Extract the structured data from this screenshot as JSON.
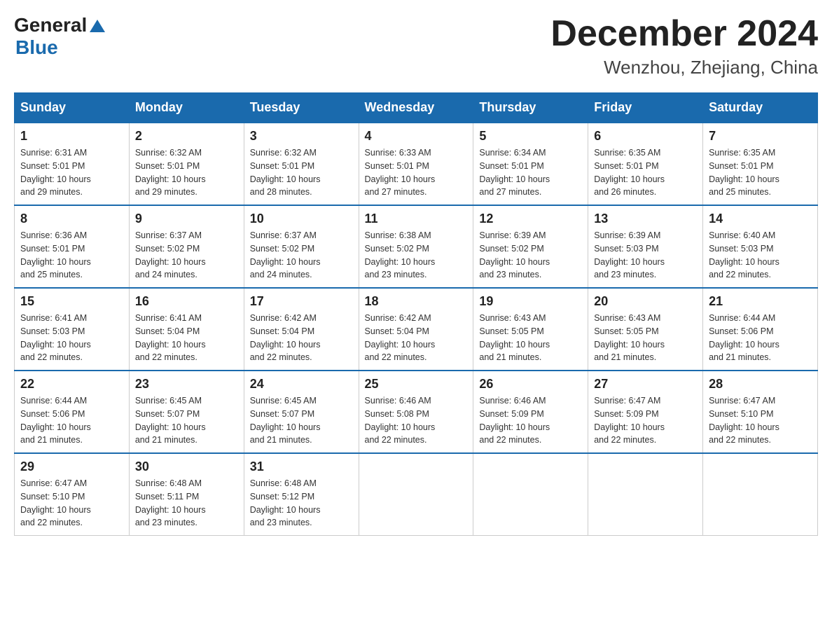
{
  "header": {
    "logo": {
      "general": "General",
      "blue": "Blue",
      "alt": "GeneralBlue logo"
    },
    "title": "December 2024",
    "subtitle": "Wenzhou, Zhejiang, China"
  },
  "weekdays": [
    "Sunday",
    "Monday",
    "Tuesday",
    "Wednesday",
    "Thursday",
    "Friday",
    "Saturday"
  ],
  "weeks": [
    [
      {
        "day": "1",
        "sunrise": "6:31 AM",
        "sunset": "5:01 PM",
        "daylight": "10 hours and 29 minutes."
      },
      {
        "day": "2",
        "sunrise": "6:32 AM",
        "sunset": "5:01 PM",
        "daylight": "10 hours and 29 minutes."
      },
      {
        "day": "3",
        "sunrise": "6:32 AM",
        "sunset": "5:01 PM",
        "daylight": "10 hours and 28 minutes."
      },
      {
        "day": "4",
        "sunrise": "6:33 AM",
        "sunset": "5:01 PM",
        "daylight": "10 hours and 27 minutes."
      },
      {
        "day": "5",
        "sunrise": "6:34 AM",
        "sunset": "5:01 PM",
        "daylight": "10 hours and 27 minutes."
      },
      {
        "day": "6",
        "sunrise": "6:35 AM",
        "sunset": "5:01 PM",
        "daylight": "10 hours and 26 minutes."
      },
      {
        "day": "7",
        "sunrise": "6:35 AM",
        "sunset": "5:01 PM",
        "daylight": "10 hours and 25 minutes."
      }
    ],
    [
      {
        "day": "8",
        "sunrise": "6:36 AM",
        "sunset": "5:01 PM",
        "daylight": "10 hours and 25 minutes."
      },
      {
        "day": "9",
        "sunrise": "6:37 AM",
        "sunset": "5:02 PM",
        "daylight": "10 hours and 24 minutes."
      },
      {
        "day": "10",
        "sunrise": "6:37 AM",
        "sunset": "5:02 PM",
        "daylight": "10 hours and 24 minutes."
      },
      {
        "day": "11",
        "sunrise": "6:38 AM",
        "sunset": "5:02 PM",
        "daylight": "10 hours and 23 minutes."
      },
      {
        "day": "12",
        "sunrise": "6:39 AM",
        "sunset": "5:02 PM",
        "daylight": "10 hours and 23 minutes."
      },
      {
        "day": "13",
        "sunrise": "6:39 AM",
        "sunset": "5:03 PM",
        "daylight": "10 hours and 23 minutes."
      },
      {
        "day": "14",
        "sunrise": "6:40 AM",
        "sunset": "5:03 PM",
        "daylight": "10 hours and 22 minutes."
      }
    ],
    [
      {
        "day": "15",
        "sunrise": "6:41 AM",
        "sunset": "5:03 PM",
        "daylight": "10 hours and 22 minutes."
      },
      {
        "day": "16",
        "sunrise": "6:41 AM",
        "sunset": "5:04 PM",
        "daylight": "10 hours and 22 minutes."
      },
      {
        "day": "17",
        "sunrise": "6:42 AM",
        "sunset": "5:04 PM",
        "daylight": "10 hours and 22 minutes."
      },
      {
        "day": "18",
        "sunrise": "6:42 AM",
        "sunset": "5:04 PM",
        "daylight": "10 hours and 22 minutes."
      },
      {
        "day": "19",
        "sunrise": "6:43 AM",
        "sunset": "5:05 PM",
        "daylight": "10 hours and 21 minutes."
      },
      {
        "day": "20",
        "sunrise": "6:43 AM",
        "sunset": "5:05 PM",
        "daylight": "10 hours and 21 minutes."
      },
      {
        "day": "21",
        "sunrise": "6:44 AM",
        "sunset": "5:06 PM",
        "daylight": "10 hours and 21 minutes."
      }
    ],
    [
      {
        "day": "22",
        "sunrise": "6:44 AM",
        "sunset": "5:06 PM",
        "daylight": "10 hours and 21 minutes."
      },
      {
        "day": "23",
        "sunrise": "6:45 AM",
        "sunset": "5:07 PM",
        "daylight": "10 hours and 21 minutes."
      },
      {
        "day": "24",
        "sunrise": "6:45 AM",
        "sunset": "5:07 PM",
        "daylight": "10 hours and 21 minutes."
      },
      {
        "day": "25",
        "sunrise": "6:46 AM",
        "sunset": "5:08 PM",
        "daylight": "10 hours and 22 minutes."
      },
      {
        "day": "26",
        "sunrise": "6:46 AM",
        "sunset": "5:09 PM",
        "daylight": "10 hours and 22 minutes."
      },
      {
        "day": "27",
        "sunrise": "6:47 AM",
        "sunset": "5:09 PM",
        "daylight": "10 hours and 22 minutes."
      },
      {
        "day": "28",
        "sunrise": "6:47 AM",
        "sunset": "5:10 PM",
        "daylight": "10 hours and 22 minutes."
      }
    ],
    [
      {
        "day": "29",
        "sunrise": "6:47 AM",
        "sunset": "5:10 PM",
        "daylight": "10 hours and 22 minutes."
      },
      {
        "day": "30",
        "sunrise": "6:48 AM",
        "sunset": "5:11 PM",
        "daylight": "10 hours and 23 minutes."
      },
      {
        "day": "31",
        "sunrise": "6:48 AM",
        "sunset": "5:12 PM",
        "daylight": "10 hours and 23 minutes."
      },
      null,
      null,
      null,
      null
    ]
  ],
  "labels": {
    "sunrise": "Sunrise:",
    "sunset": "Sunset:",
    "daylight": "Daylight:"
  }
}
